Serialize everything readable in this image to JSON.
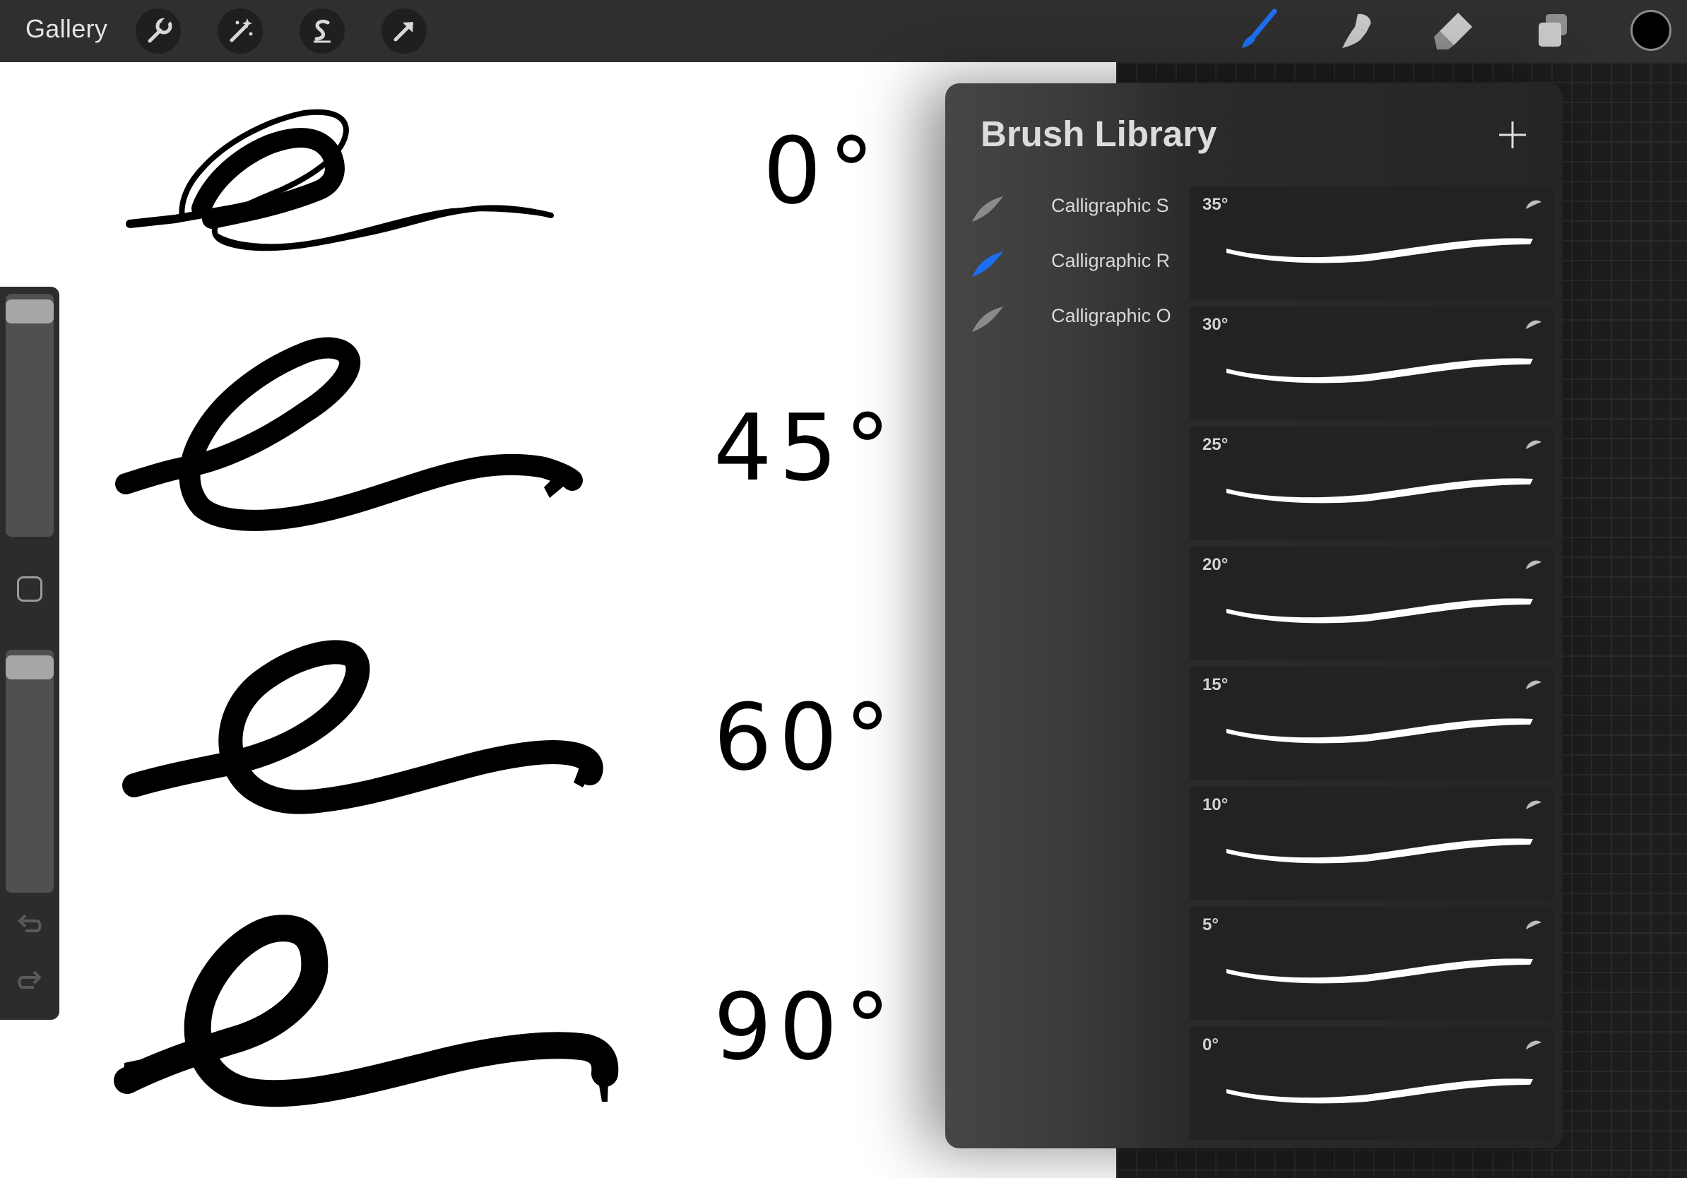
{
  "toolbar": {
    "gallery_label": "Gallery",
    "left_tools": [
      {
        "name": "wrench-icon",
        "label": "Actions"
      },
      {
        "name": "magic-wand-icon",
        "label": "Adjustments"
      },
      {
        "name": "selection-icon",
        "label": "Selection"
      },
      {
        "name": "arrow-icon",
        "label": "Transform"
      }
    ],
    "right_tools": [
      {
        "name": "brush-icon",
        "active": true
      },
      {
        "name": "smudge-icon",
        "active": false
      },
      {
        "name": "eraser-icon",
        "active": false
      },
      {
        "name": "layers-icon",
        "active": false
      }
    ],
    "current_color": "#000000",
    "accent_color": "#1e6ff0"
  },
  "canvas": {
    "labels": [
      "0°",
      "45°",
      "60°",
      "90°"
    ]
  },
  "sidebar": {
    "icons": [
      "undo-icon",
      "redo-icon"
    ]
  },
  "brush_library": {
    "title": "Brush Library",
    "brush_sets": [
      {
        "label": "Calligraphic S",
        "selected": false
      },
      {
        "label": "Calligraphic R",
        "selected": true
      },
      {
        "label": "Calligraphic O",
        "selected": false
      }
    ],
    "brushes": [
      "35°",
      "30°",
      "25°",
      "20°",
      "15°",
      "10°",
      "5°",
      "0°"
    ]
  }
}
